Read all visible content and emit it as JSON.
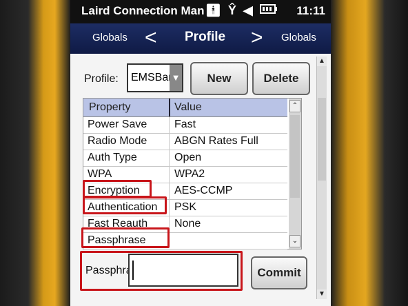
{
  "status_bar": {
    "title": "Laird Connection Man",
    "time": "11:11",
    "icons": [
      "person-icon",
      "antenna-off-icon",
      "speaker-icon",
      "battery-icon"
    ]
  },
  "nav": {
    "left_label": "Globals",
    "prev_glyph": "<",
    "title": "Profile",
    "next_glyph": ">",
    "right_label": "Globals"
  },
  "profile": {
    "label": "Profile:",
    "selected": "EMSBar",
    "new_label": "New",
    "delete_label": "Delete"
  },
  "table": {
    "columns": [
      "Property",
      "Value"
    ],
    "rows": [
      {
        "property": "Power Save",
        "value": "Fast"
      },
      {
        "property": "Radio Mode",
        "value": "ABGN Rates Full"
      },
      {
        "property": "Auth Type",
        "value": "Open"
      },
      {
        "property": "WPA",
        "value": "WPA2"
      },
      {
        "property": "Encryption",
        "value": "AES-CCMP"
      },
      {
        "property": "Authentication",
        "value": "PSK"
      },
      {
        "property": "Fast Reauth",
        "value": "None"
      },
      {
        "property": "Passphrase",
        "value": ""
      }
    ]
  },
  "edit": {
    "label": "Passphrase",
    "value": "",
    "commit_label": "Commit"
  },
  "colors": {
    "highlight": "#c8151a",
    "nav_bg": "#1d2d63",
    "header_bg": "#b9c3e6",
    "device_yellow": "#e6a820"
  }
}
